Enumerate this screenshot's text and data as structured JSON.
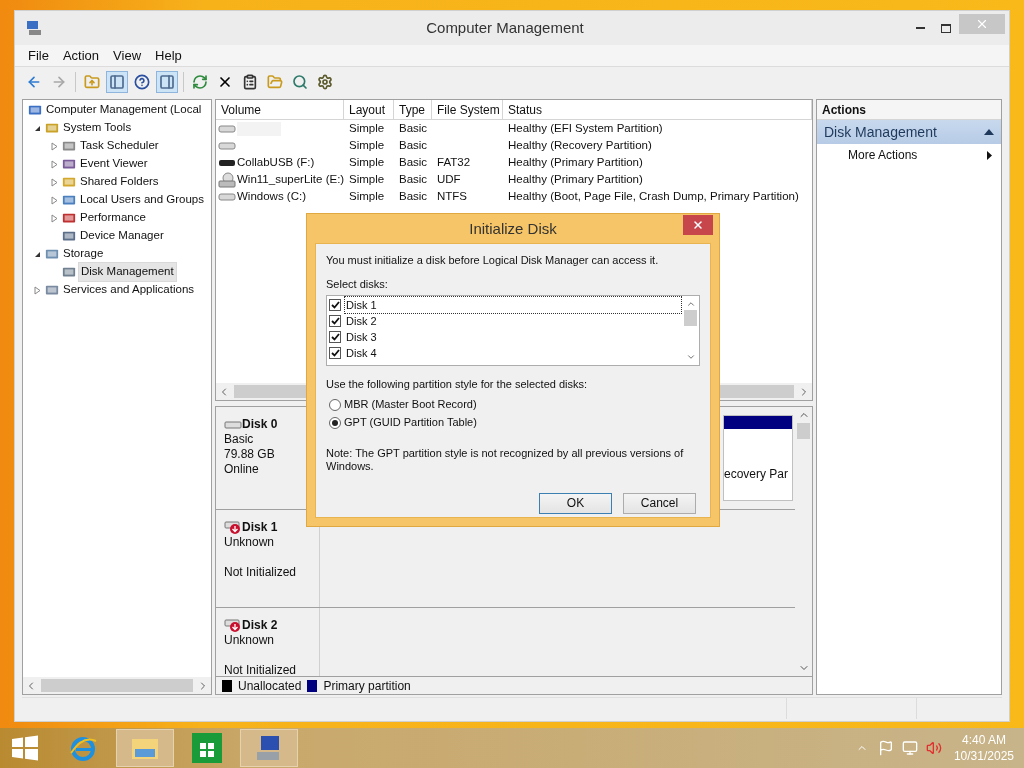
{
  "window": {
    "title": "Computer Management"
  },
  "menu": [
    "File",
    "Action",
    "View",
    "Help"
  ],
  "toolbar": [
    {
      "pressed": false,
      "disabled": false
    },
    {
      "pressed": false,
      "disabled": true
    },
    {
      "pressed": false,
      "disabled": false
    },
    {
      "pressed": true,
      "disabled": false
    },
    {
      "pressed": false,
      "disabled": false
    },
    {
      "pressed": true,
      "disabled": false
    },
    {
      "pressed": false,
      "disabled": false
    },
    {
      "pressed": false,
      "disabled": false
    },
    {
      "pressed": false,
      "disabled": false
    },
    {
      "pressed": false,
      "disabled": false
    },
    {
      "pressed": false,
      "disabled": false
    },
    {
      "pressed": false,
      "disabled": false
    }
  ],
  "tree": [
    {
      "label": "Computer Management (Local",
      "expandable": false,
      "selected": false,
      "children": [
        {
          "label": "System Tools",
          "expandable": true,
          "expanded": true,
          "selected": false,
          "children": [
            {
              "label": "Task Scheduler",
              "expandable": true,
              "expanded": false,
              "selected": false
            },
            {
              "label": "Event Viewer",
              "expandable": true,
              "expanded": false,
              "selected": false
            },
            {
              "label": "Shared Folders",
              "expandable": true,
              "expanded": false,
              "selected": false
            },
            {
              "label": "Local Users and Groups",
              "expandable": true,
              "expanded": false,
              "selected": false
            },
            {
              "label": "Performance",
              "expandable": true,
              "expanded": false,
              "selected": false
            },
            {
              "label": "Device Manager",
              "expandable": false,
              "selected": false
            }
          ]
        },
        {
          "label": "Storage",
          "expandable": true,
          "expanded": true,
          "selected": false,
          "children": [
            {
              "label": "Disk Management",
              "expandable": false,
              "selected": true
            }
          ]
        },
        {
          "label": "Services and Applications",
          "expandable": true,
          "expanded": false,
          "selected": false
        }
      ]
    }
  ],
  "volumes": {
    "columns": [
      "Volume",
      "Layout",
      "Type",
      "File System",
      "Status"
    ],
    "rows": [
      {
        "kind": "disk",
        "redacted": true,
        "layout": "Simple",
        "type": "Basic",
        "status": "Healthy (EFI System Partition)"
      },
      {
        "kind": "disk",
        "redacted": false,
        "layout": "Simple",
        "type": "Basic",
        "status": "Healthy (Recovery Partition)"
      },
      {
        "kind": "usb",
        "redacted": false,
        "volume": "CollabUSB (F:)",
        "layout": "Simple",
        "type": "Basic",
        "file_system": "FAT32",
        "status": "Healthy (Primary Partition)"
      },
      {
        "kind": "optical",
        "redacted": false,
        "volume": "Win11_superLite (E:)",
        "layout": "Simple",
        "type": "Basic",
        "file_system": "UDF",
        "status": "Healthy (Primary Partition)"
      },
      {
        "kind": "disk",
        "redacted": false,
        "volume": "Windows (C:)",
        "layout": "Simple",
        "type": "Basic",
        "file_system": "NTFS",
        "status": "Healthy (Boot, Page File, Crash Dump, Primary Partition)"
      }
    ]
  },
  "disks": [
    {
      "name": "Disk 0",
      "initialized": true,
      "type": "Basic",
      "size": "79.88 GB",
      "status": "Online",
      "partition_label": "ecovery Par"
    },
    {
      "name": "Disk 1",
      "initialized": false,
      "type": "Unknown",
      "status": "Not Initialized"
    },
    {
      "name": "Disk 2",
      "initialized": false,
      "type": "Unknown",
      "status": "Not Initialized"
    }
  ],
  "legend": [
    {
      "label": "Unallocated",
      "color": "#000000"
    },
    {
      "label": "Primary partition",
      "color": "#000080"
    }
  ],
  "actions": {
    "title": "Actions",
    "section": "Disk Management",
    "expanded": true,
    "items": [
      "More Actions"
    ]
  },
  "dialog": {
    "title": "Initialize Disk",
    "message": "You must initialize a disk before Logical Disk Manager can access it.",
    "select_label": "Select disks:",
    "disks": [
      {
        "label": "Disk 1",
        "checked": true,
        "selected": true
      },
      {
        "label": "Disk 2",
        "checked": true,
        "selected": false
      },
      {
        "label": "Disk 3",
        "checked": true,
        "selected": false
      },
      {
        "label": "Disk 4",
        "checked": true,
        "selected": false
      }
    ],
    "style_label": "Use the following partition style for the selected disks:",
    "styles": [
      {
        "label": "MBR (Master Boot Record)",
        "selected": false
      },
      {
        "label": "GPT (GUID Partition Table)",
        "selected": true
      }
    ],
    "note": "Note: The GPT partition style is not recognized by all previous versions of Windows.",
    "buttons": [
      {
        "label": "OK",
        "default": true
      },
      {
        "label": "Cancel",
        "default": false
      }
    ]
  },
  "taskbar": {
    "apps": [
      {
        "selected": false
      },
      {
        "selected": true
      },
      {
        "selected": false
      },
      {
        "selected": true
      }
    ],
    "time": "4:40 AM",
    "date": "10/31/2025"
  }
}
